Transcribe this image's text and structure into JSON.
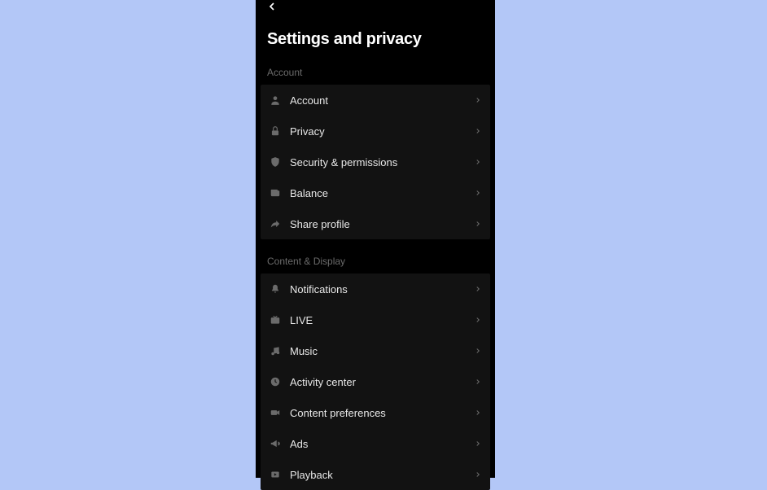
{
  "header": {
    "title": "Settings and privacy"
  },
  "sections": [
    {
      "label": "Account",
      "items": [
        {
          "label": "Account"
        },
        {
          "label": "Privacy"
        },
        {
          "label": "Security & permissions"
        },
        {
          "label": "Balance"
        },
        {
          "label": "Share profile"
        }
      ]
    },
    {
      "label": "Content & Display",
      "items": [
        {
          "label": "Notifications"
        },
        {
          "label": "LIVE"
        },
        {
          "label": "Music"
        },
        {
          "label": "Activity center"
        },
        {
          "label": "Content preferences"
        },
        {
          "label": "Ads"
        },
        {
          "label": "Playback"
        }
      ]
    }
  ]
}
